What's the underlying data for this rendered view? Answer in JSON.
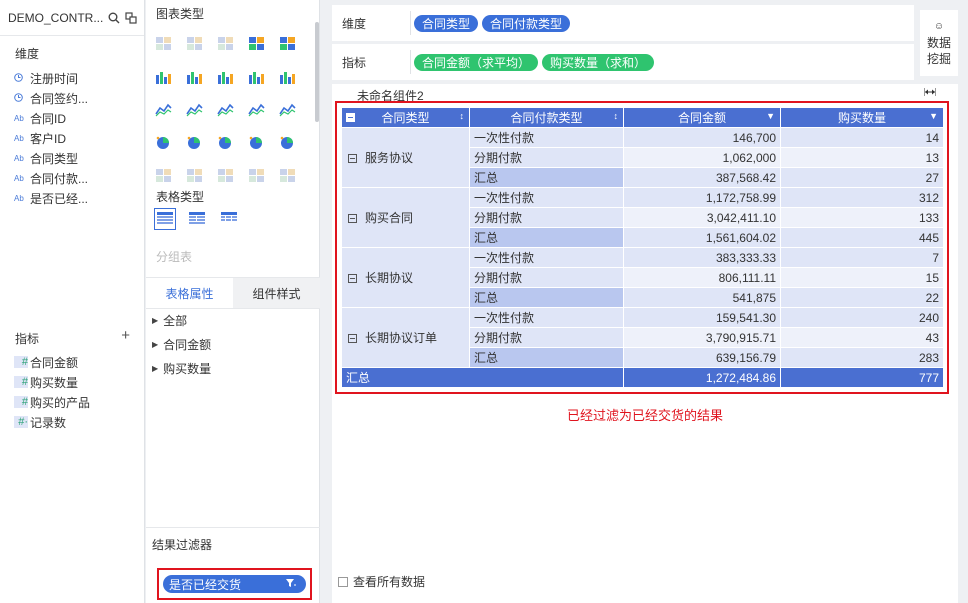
{
  "left": {
    "dataset_name": "DEMO_CONTR...",
    "dimensions_title": "维度",
    "dimensions": [
      {
        "type": "time",
        "label": "注册时间"
      },
      {
        "type": "time",
        "label": "合同签约..."
      },
      {
        "type": "Ab",
        "label": "合同ID"
      },
      {
        "type": "Ab",
        "label": "客户ID"
      },
      {
        "type": "Ab",
        "label": "合同类型"
      },
      {
        "type": "Ab",
        "label": "合同付款..."
      },
      {
        "type": "Ab",
        "label": "是否已经..."
      }
    ],
    "metrics_title": "指标",
    "metrics": [
      {
        "type": "#",
        "label": "合同金额"
      },
      {
        "type": "#",
        "label": "购买数量"
      },
      {
        "type": "#",
        "label": "购买的产品"
      },
      {
        "type": "#·",
        "label": "记录数"
      }
    ]
  },
  "middle": {
    "chart_type_title": "图表类型",
    "table_type_title": "表格类型",
    "group_table_label": "分组表",
    "tabs": [
      "表格属性",
      "组件样式"
    ],
    "properties": [
      "全部",
      "合同金额",
      "购买数量"
    ],
    "filter_title": "结果过滤器",
    "filter_pill": "是否已经交货"
  },
  "shelves": {
    "dimension_label": "维度",
    "dimension_pills": [
      "合同类型",
      "合同付款类型"
    ],
    "metric_label": "指标",
    "metric_pills": [
      "合同金额（求平均）",
      "购买数量（求和）"
    ],
    "mining_line1": "数据",
    "mining_line2": "挖掘"
  },
  "canvas": {
    "component_title": "未命名组件2",
    "headers": [
      "合同类型",
      "合同付款类型",
      "合同金额",
      "购买数量"
    ],
    "groups": [
      {
        "name": "服务协议",
        "rows": [
          {
            "type": "一次性付款",
            "amount": "146,700",
            "qty": "14"
          },
          {
            "type": "分期付款",
            "amount": "1,062,000",
            "qty": "13"
          },
          {
            "type": "汇总",
            "amount": "387,568.42",
            "qty": "27"
          }
        ]
      },
      {
        "name": "购买合同",
        "rows": [
          {
            "type": "一次性付款",
            "amount": "1,172,758.99",
            "qty": "312"
          },
          {
            "type": "分期付款",
            "amount": "3,042,411.10",
            "qty": "133"
          },
          {
            "type": "汇总",
            "amount": "1,561,604.02",
            "qty": "445"
          }
        ]
      },
      {
        "name": "长期协议",
        "rows": [
          {
            "type": "一次性付款",
            "amount": "383,333.33",
            "qty": "7"
          },
          {
            "type": "分期付款",
            "amount": "806,111.11",
            "qty": "15"
          },
          {
            "type": "汇总",
            "amount": "541,875",
            "qty": "22"
          }
        ]
      },
      {
        "name": "长期协议订单",
        "rows": [
          {
            "type": "一次性付款",
            "amount": "159,541.30",
            "qty": "240"
          },
          {
            "type": "分期付款",
            "amount": "3,790,915.71",
            "qty": "43"
          },
          {
            "type": "汇总",
            "amount": "639,156.79",
            "qty": "283"
          }
        ]
      }
    ],
    "grand_total": {
      "label": "汇总",
      "amount": "1,272,484.86",
      "qty": "777"
    },
    "annotation": "已经过滤为已经交货的结果",
    "view_all": "查看所有数据"
  },
  "colors": {
    "accent": "#3a6fd9",
    "header_blue": "#4a6fd1",
    "metric_green": "#2fc46f",
    "highlight_red": "#e0141e"
  }
}
